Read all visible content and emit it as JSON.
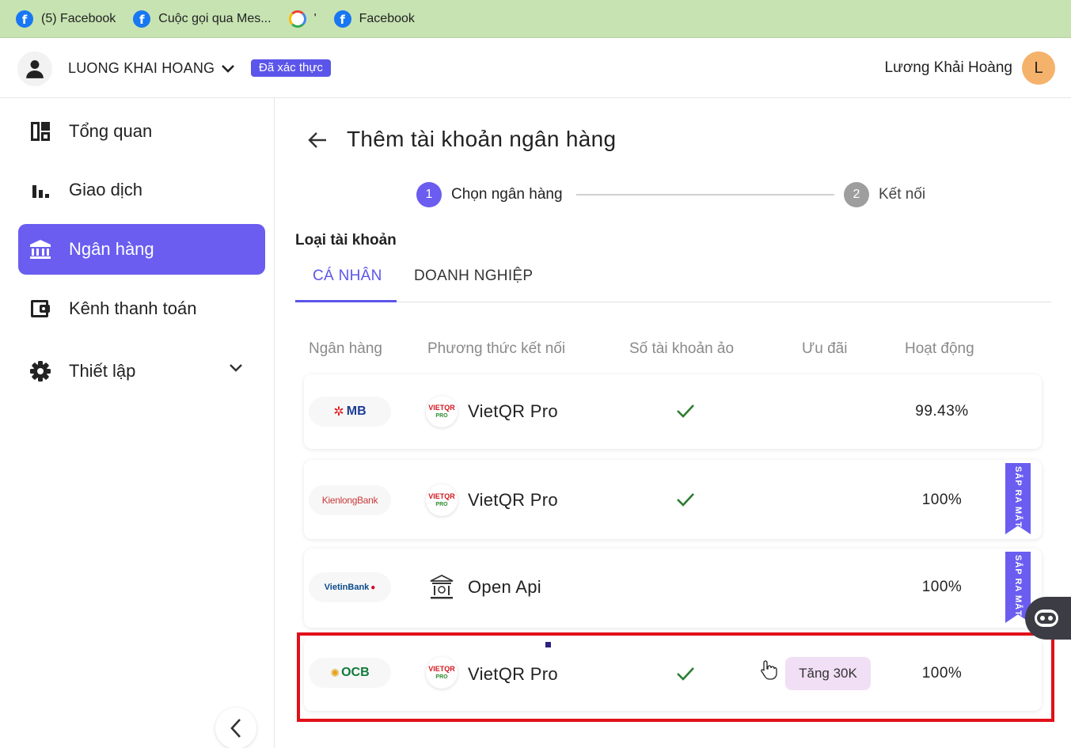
{
  "bookmarks": [
    {
      "label": "(5) Facebook",
      "icon": "facebook-icon"
    },
    {
      "label": "Cuộc gọi qua Mes...",
      "icon": "facebook-icon"
    },
    {
      "label": "'",
      "icon": "google-icon"
    },
    {
      "label": "Facebook",
      "icon": "facebook-icon"
    }
  ],
  "header": {
    "account_name": "LUONG KHAI HOANG",
    "verified": "Đã xác thực",
    "user_name": "Lương Khải Hoàng",
    "user_initial": "L"
  },
  "sidebar": {
    "items": [
      {
        "label": "Tổng quan",
        "icon": "dashboard-icon"
      },
      {
        "label": "Giao dịch",
        "icon": "bar-chart-icon"
      },
      {
        "label": "Ngân hàng",
        "icon": "bank-icon",
        "active": true
      },
      {
        "label": "Kênh thanh toán",
        "icon": "wallet-icon"
      },
      {
        "label": "Thiết lập",
        "icon": "gear-icon"
      }
    ]
  },
  "main": {
    "title": "Thêm tài khoản ngân hàng",
    "steps": [
      {
        "num": "1",
        "label": "Chọn ngân hàng"
      },
      {
        "num": "2",
        "label": "Kết nối"
      }
    ],
    "account_type_label": "Loại tài khoản",
    "tabs": [
      "CÁ NHÂN",
      "DOANH NGHIỆP"
    ],
    "columns": [
      "Ngân hàng",
      "Phương thức kết nối",
      "Số tài khoản ảo",
      "Ưu đãi",
      "Hoạt động"
    ],
    "rows": [
      {
        "bank": "MB",
        "method": "VietQR Pro",
        "virtual": true,
        "promo": "",
        "uptime": "99.43%",
        "ribbon": ""
      },
      {
        "bank": "KienlongBank",
        "method": "VietQR Pro",
        "virtual": true,
        "promo": "",
        "uptime": "100%",
        "ribbon": "SẮP RA MẮT"
      },
      {
        "bank": "VietinBank",
        "method": "Open Api",
        "virtual": false,
        "promo": "",
        "uptime": "100%",
        "ribbon": "SẮP RA MẮT"
      },
      {
        "bank": "OCB",
        "method": "VietQR Pro",
        "virtual": true,
        "promo": "Tăng 30K",
        "uptime": "100%",
        "ribbon": ""
      }
    ],
    "vietqr_icon_text": "VIETQR",
    "vietqr_icon_sub": "PRO"
  },
  "colors": {
    "accent": "#6a5df0",
    "bookmark_bar": "#c7e3b2",
    "highlight": "#e0101a",
    "check": "#2e7d32"
  }
}
